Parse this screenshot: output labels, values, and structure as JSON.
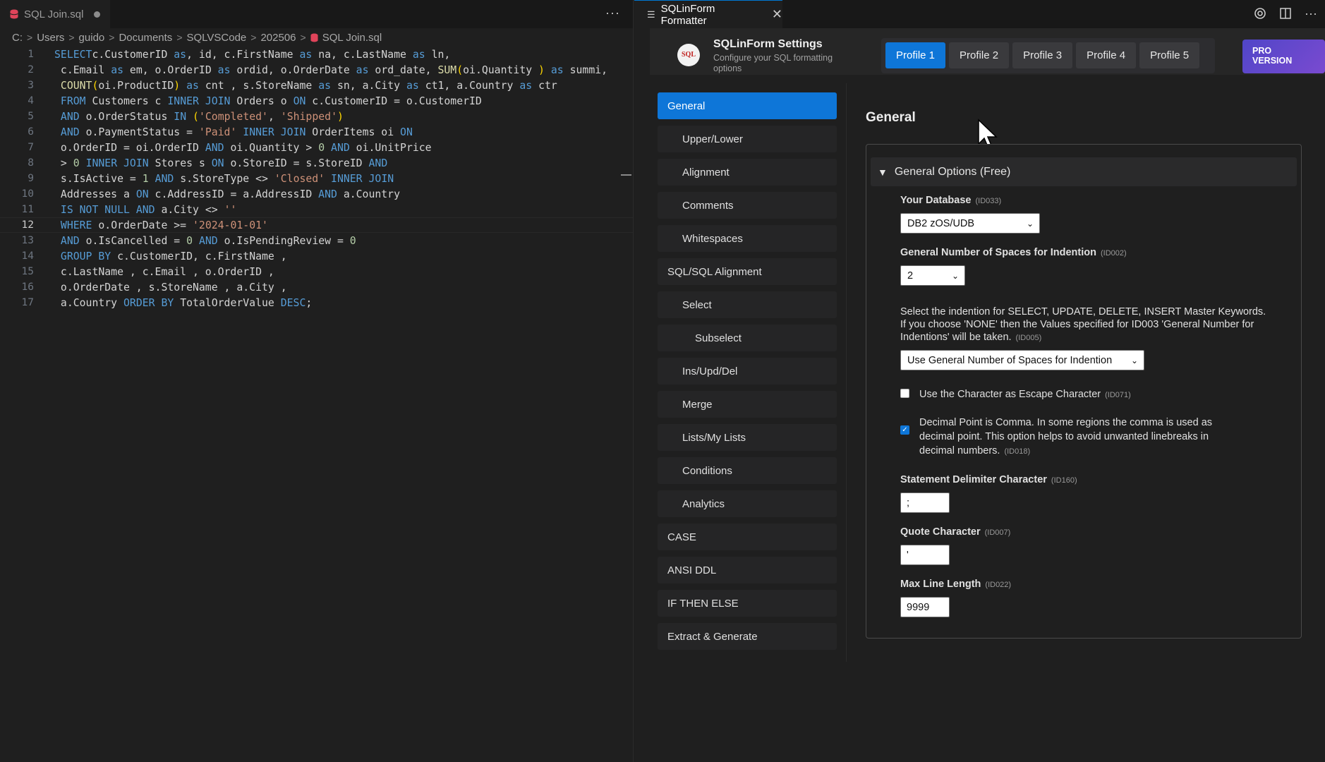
{
  "editor": {
    "tab_label": "SQL Join.sql",
    "more_label": "···",
    "breadcrumb": [
      "C:",
      "Users",
      "guido",
      "Documents",
      "SQLVSCode",
      "202506",
      "SQL Join.sql"
    ],
    "lines": [
      {
        "n": "1",
        "tokens": [
          [
            "kw",
            "SELECT"
          ],
          [
            "",
            "c.CustomerID "
          ],
          [
            "kw",
            "as"
          ],
          [
            "",
            ", id, c.FirstName "
          ],
          [
            "kw",
            "as"
          ],
          [
            "",
            " na, c.LastName "
          ],
          [
            "kw",
            "as"
          ],
          [
            "",
            " ln,"
          ]
        ]
      },
      {
        "n": "2",
        "tokens": [
          [
            "",
            " c.Email "
          ],
          [
            "kw",
            "as"
          ],
          [
            "",
            " em, o.OrderID "
          ],
          [
            "kw",
            "as"
          ],
          [
            "",
            " ordid, o.OrderDate "
          ],
          [
            "kw",
            "as"
          ],
          [
            "",
            " ord_date, "
          ],
          [
            "fn",
            "SUM"
          ],
          [
            "pn",
            "("
          ],
          [
            "",
            "oi.Quantity "
          ],
          [
            "pn",
            ")"
          ],
          [
            "",
            ""
          ],
          [
            "kw",
            " as"
          ],
          [
            "",
            " summi,"
          ]
        ]
      },
      {
        "n": "3",
        "tokens": [
          [
            "",
            " "
          ],
          [
            "fn",
            "COUNT"
          ],
          [
            "pn",
            "("
          ],
          [
            "",
            "oi.ProductID"
          ],
          [
            "pn",
            ")"
          ],
          [
            "",
            " "
          ],
          [
            "kw",
            "as"
          ],
          [
            "",
            " cnt , s.StoreName "
          ],
          [
            "kw",
            "as"
          ],
          [
            "",
            " sn, a.City "
          ],
          [
            "kw",
            "as"
          ],
          [
            "",
            " ct1, a.Country "
          ],
          [
            "kw",
            "as"
          ],
          [
            "",
            " ctr"
          ]
        ]
      },
      {
        "n": "4",
        "tokens": [
          [
            "",
            " "
          ],
          [
            "kw",
            "FROM"
          ],
          [
            "",
            " Customers c "
          ],
          [
            "kw",
            "INNER JOIN"
          ],
          [
            "",
            " Orders o "
          ],
          [
            "kw",
            "ON"
          ],
          [
            "",
            " c.CustomerID = o.CustomerID"
          ]
        ]
      },
      {
        "n": "5",
        "tokens": [
          [
            "",
            " "
          ],
          [
            "kw",
            "AND"
          ],
          [
            "",
            " o.OrderStatus "
          ],
          [
            "kw",
            "IN"
          ],
          [
            "",
            " "
          ],
          [
            "pn",
            "("
          ],
          [
            "str",
            "'Completed'"
          ],
          [
            "",
            ", "
          ],
          [
            "str",
            "'Shipped'"
          ],
          [
            "pn",
            ")"
          ]
        ]
      },
      {
        "n": "6",
        "tokens": [
          [
            "",
            " "
          ],
          [
            "kw",
            "AND"
          ],
          [
            "",
            " o.PaymentStatus = "
          ],
          [
            "str",
            "'Paid'"
          ],
          [
            "",
            " "
          ],
          [
            "kw",
            "INNER JOIN"
          ],
          [
            "",
            " OrderItems oi "
          ],
          [
            "kw",
            "ON"
          ]
        ]
      },
      {
        "n": "7",
        "tokens": [
          [
            "",
            " o.OrderID = oi.OrderID "
          ],
          [
            "kw",
            "AND"
          ],
          [
            "",
            " oi.Quantity > "
          ],
          [
            "num",
            "0"
          ],
          [
            "",
            " "
          ],
          [
            "kw",
            "AND"
          ],
          [
            "",
            " oi.UnitPrice"
          ]
        ]
      },
      {
        "n": "8",
        "tokens": [
          [
            "",
            " > "
          ],
          [
            "num",
            "0"
          ],
          [
            "",
            " "
          ],
          [
            "kw",
            "INNER JOIN"
          ],
          [
            "",
            " Stores s "
          ],
          [
            "kw",
            "ON"
          ],
          [
            "",
            " o.StoreID = s.StoreID "
          ],
          [
            "kw",
            "AND"
          ]
        ]
      },
      {
        "n": "9",
        "tokens": [
          [
            "",
            " s.IsActive = "
          ],
          [
            "num",
            "1"
          ],
          [
            "",
            " "
          ],
          [
            "kw",
            "AND"
          ],
          [
            "",
            " s.StoreType <> "
          ],
          [
            "str",
            "'Closed'"
          ],
          [
            "",
            " "
          ],
          [
            "kw",
            "INNER JOIN"
          ]
        ]
      },
      {
        "n": "10",
        "tokens": [
          [
            "",
            " Addresses a "
          ],
          [
            "kw",
            "ON"
          ],
          [
            "",
            " c.AddressID = a.AddressID "
          ],
          [
            "kw",
            "AND"
          ],
          [
            "",
            " a.Country"
          ]
        ]
      },
      {
        "n": "11",
        "tokens": [
          [
            "",
            " "
          ],
          [
            "kw",
            "IS NOT NULL"
          ],
          [
            "",
            " "
          ],
          [
            "kw",
            "AND"
          ],
          [
            "",
            " a.City <> "
          ],
          [
            "str",
            "''"
          ]
        ]
      },
      {
        "n": "12",
        "tokens": [
          [
            "",
            " "
          ],
          [
            "kw",
            "WHERE"
          ],
          [
            "",
            " o.OrderDate >= "
          ],
          [
            "str",
            "'2024-01-01'"
          ]
        ]
      },
      {
        "n": "13",
        "tokens": [
          [
            "",
            " "
          ],
          [
            "kw",
            "AND"
          ],
          [
            "",
            " o.IsCancelled = "
          ],
          [
            "num",
            "0"
          ],
          [
            "",
            " "
          ],
          [
            "kw",
            "AND"
          ],
          [
            "",
            " o.IsPendingReview = "
          ],
          [
            "num",
            "0"
          ]
        ]
      },
      {
        "n": "14",
        "tokens": [
          [
            "",
            " "
          ],
          [
            "kw",
            "GROUP BY"
          ],
          [
            "",
            " c.CustomerID, c.FirstName ,"
          ]
        ]
      },
      {
        "n": "15",
        "tokens": [
          [
            "",
            " c.LastName , c.Email , o.OrderID ,"
          ]
        ]
      },
      {
        "n": "16",
        "tokens": [
          [
            "",
            " o.OrderDate , s.StoreName , a.City ,"
          ]
        ]
      },
      {
        "n": "17",
        "tokens": [
          [
            "",
            " a.Country "
          ],
          [
            "kw",
            "ORDER BY"
          ],
          [
            "",
            " TotalOrderValue "
          ],
          [
            "kw",
            "DESC"
          ],
          [
            "",
            ";"
          ]
        ]
      }
    ]
  },
  "settings": {
    "tab_label": "SQLinForm Formatter",
    "title": "SQLinForm Settings",
    "subtitle": "Configure your SQL formatting options",
    "logo_text": "SQL",
    "profiles": [
      "Profile 1",
      "Profile 2",
      "Profile 3",
      "Profile 4",
      "Profile 5"
    ],
    "pro_label_1": "PRO",
    "pro_label_2": "VERSION",
    "nav": [
      {
        "label": "General",
        "level": 0,
        "active": true
      },
      {
        "label": "Upper/Lower",
        "level": 1
      },
      {
        "label": "Alignment",
        "level": 1
      },
      {
        "label": "Comments",
        "level": 1
      },
      {
        "label": "Whitespaces",
        "level": 1
      },
      {
        "label": "SQL/SQL Alignment",
        "level": 0
      },
      {
        "label": "Select",
        "level": 1
      },
      {
        "label": "Subselect",
        "level": 2
      },
      {
        "label": "Ins/Upd/Del",
        "level": 1
      },
      {
        "label": "Merge",
        "level": 1
      },
      {
        "label": "Lists/My Lists",
        "level": 1
      },
      {
        "label": "Conditions",
        "level": 1
      },
      {
        "label": "Analytics",
        "level": 1
      },
      {
        "label": "CASE",
        "level": 0
      },
      {
        "label": "ANSI DDL",
        "level": 0
      },
      {
        "label": "IF THEN ELSE",
        "level": 0
      },
      {
        "label": "Extract & Generate",
        "level": 0
      }
    ],
    "content_title": "General",
    "section_title": "General Options (Free)",
    "db": {
      "label": "Your Database",
      "id": "(ID033)",
      "value": "DB2 zOS/UDB"
    },
    "indent": {
      "label": "General Number of Spaces for Indention",
      "id": "(ID002)",
      "value": "2"
    },
    "master": {
      "desc": "Select the indention for SELECT, UPDATE, DELETE, INSERT Master Keywords. If you choose 'NONE' then the Values specified for ID003 'General Number for Indentions' will be taken.",
      "id": "(ID005)",
      "value": "Use General Number of Spaces for Indention"
    },
    "escape": {
      "label": "Use the Character as Escape Character",
      "id": "(ID071)",
      "checked": false
    },
    "decimal": {
      "label": "Decimal Point is Comma. In some regions the comma is used as decimal point. This option helps to avoid unwanted linebreaks in decimal numbers.",
      "id": "(ID018)",
      "checked": true
    },
    "delimiter": {
      "label": "Statement Delimiter Character",
      "id": "(ID160)",
      "value": ";"
    },
    "quote": {
      "label": "Quote Character",
      "id": "(ID007)",
      "value": "'"
    },
    "maxline": {
      "label": "Max Line Length",
      "id": "(ID022)",
      "value": "9999"
    }
  },
  "colors": {
    "accent": "#0e76d8",
    "pro_gradient_start": "#5046c8",
    "pro_gradient_end": "#7a4ad0",
    "sql_file_icon": "#e0445a"
  }
}
